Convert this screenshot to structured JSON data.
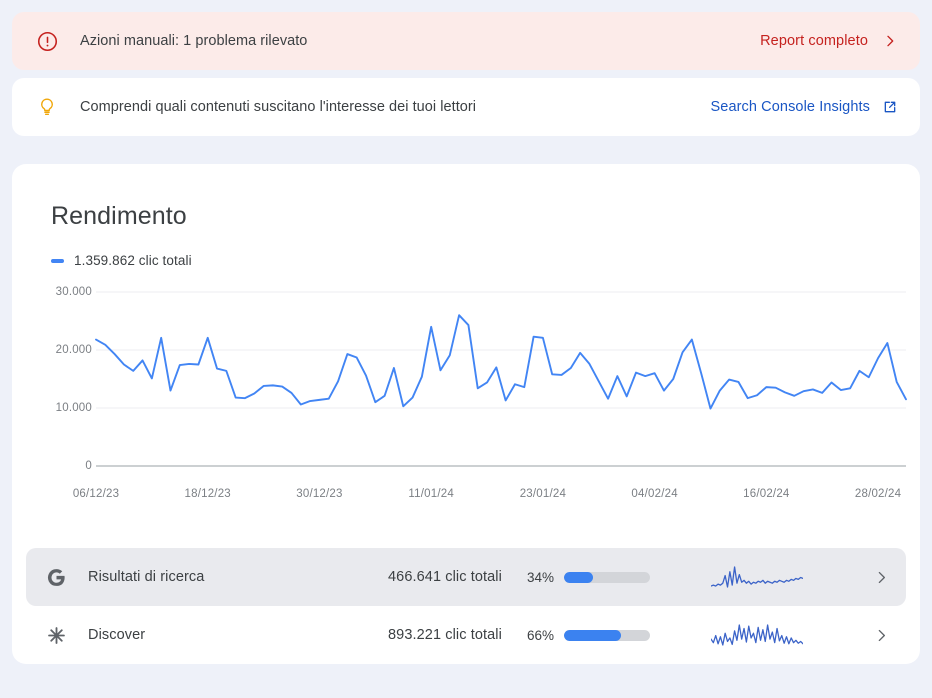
{
  "theme": {
    "page_bg": "#eef1f9",
    "card_bg": "#ffffff",
    "alert_bg": "#fcebe9",
    "alert_accent": "#c5221f",
    "link_blue": "#1a56c4",
    "line_blue": "#4285f4",
    "bar_blue": "#3b82f0",
    "bulb_amber": "#f0a70a",
    "text_primary": "#3c4043",
    "text_muted": "#7b7f84",
    "row_highlight": "#e9eaee"
  },
  "banners": {
    "manual_actions": {
      "icon": "error-circle-icon",
      "text": "Azioni manuali: 1 problema rilevato",
      "action_label": "Report completo",
      "action_icon": "chevron-right-icon"
    },
    "insights": {
      "icon": "lightbulb-icon",
      "text": "Comprendi quali contenuti suscitano l'interesse dei tuoi lettori",
      "action_label": "Search Console Insights",
      "action_icon": "external-link-icon"
    }
  },
  "performance": {
    "title": "Rendimento",
    "legend_label": "1.359.862 clic totali"
  },
  "chart_data": {
    "type": "line",
    "title": "Rendimento",
    "xlabel": "",
    "ylabel": "",
    "ylim": [
      0,
      30000
    ],
    "grid": true,
    "legend_position": "top-left",
    "series": [
      {
        "name": "1.359.862 clic totali",
        "color": "#4285f4",
        "values": [
          21800,
          20900,
          19300,
          17500,
          16400,
          18200,
          15100,
          22100,
          13000,
          17400,
          17600,
          17500,
          22100,
          16800,
          16400,
          11800,
          11700,
          12500,
          13800,
          13900,
          13700,
          12600,
          10600,
          11200,
          11400,
          11600,
          14600,
          19300,
          18700,
          15600,
          11000,
          12100,
          16900,
          10300,
          11800,
          15400,
          24000,
          16500,
          19100,
          26000,
          24300,
          13400,
          14400,
          17000,
          11300,
          14100,
          13600,
          22300,
          22100,
          15800,
          15700,
          16900,
          19500,
          17600,
          14600,
          11600,
          15500,
          12000,
          16100,
          15500,
          16000,
          13000,
          15000,
          19600,
          21800,
          16000,
          9900,
          13000,
          14900,
          14500,
          11700,
          12200,
          13600,
          13500,
          12700,
          12100,
          12900,
          13200,
          12600,
          14400,
          13100,
          13400,
          16400,
          15300,
          18600,
          21200,
          14500,
          11500
        ]
      }
    ],
    "ytick_labels": [
      "0",
      "10.000",
      "20.000",
      "30.000"
    ],
    "ytick_values": [
      0,
      10000,
      20000,
      30000
    ],
    "xtick_labels": [
      "06/12/23",
      "18/12/23",
      "30/12/23",
      "11/01/24",
      "23/01/24",
      "04/02/24",
      "16/02/24",
      "28/02/24"
    ],
    "xtick_indices": [
      0,
      12,
      24,
      36,
      48,
      60,
      72,
      84
    ]
  },
  "sources": [
    {
      "icon": "google-g-icon",
      "name": "Risultati di ricerca",
      "clicks": "466.641 clic totali",
      "percent_label": "34%",
      "percent_value": 34,
      "highlighted": true,
      "sparkline": [
        10,
        11,
        10,
        12,
        11,
        13,
        21,
        9,
        25,
        11,
        30,
        13,
        22,
        14,
        16,
        13,
        15,
        12,
        14,
        13,
        15,
        14,
        16,
        13,
        15,
        14,
        13,
        15,
        14,
        16,
        15,
        14,
        16,
        15,
        17,
        16,
        18,
        17,
        19,
        18
      ],
      "chevron": "chevron-right-icon"
    },
    {
      "icon": "discover-burst-icon",
      "name": "Discover",
      "clicks": "893.221 clic totali",
      "percent_label": "66%",
      "percent_value": 66,
      "highlighted": false,
      "sparkline": [
        20,
        14,
        26,
        12,
        24,
        10,
        30,
        16,
        22,
        11,
        34,
        18,
        44,
        20,
        38,
        15,
        42,
        22,
        30,
        14,
        40,
        18,
        36,
        16,
        44,
        20,
        32,
        14,
        38,
        17,
        26,
        13,
        24,
        12,
        22,
        14,
        18,
        13,
        16,
        12
      ],
      "chevron": "chevron-right-icon"
    }
  ]
}
